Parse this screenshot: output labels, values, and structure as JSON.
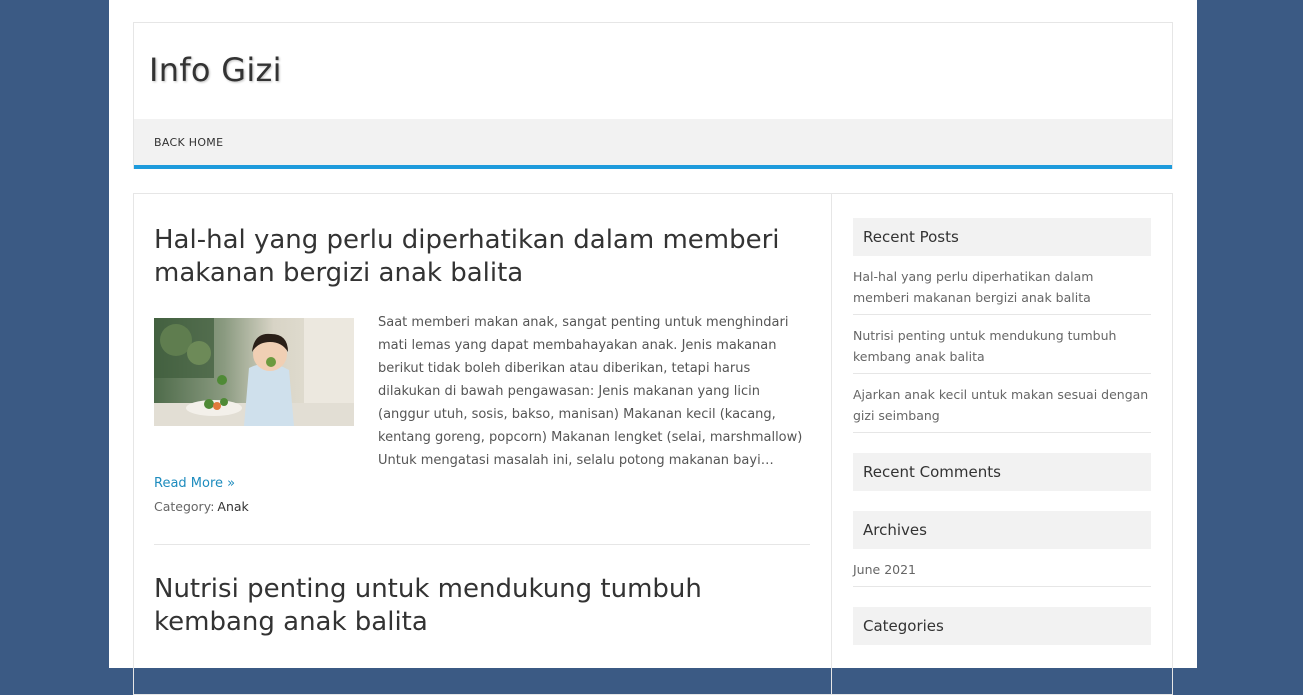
{
  "site": {
    "title": "Info Gizi"
  },
  "nav": {
    "items": [
      "BACK HOME"
    ]
  },
  "posts": [
    {
      "title": "Hal-hal yang perlu diperhatikan dalam memberi makanan bergizi anak balita",
      "excerpt": "Saat memberi makan anak, sangat penting untuk menghindari mati lemas yang dapat membahayakan anak. Jenis makanan berikut tidak boleh diberikan atau diberikan, tetapi harus dilakukan di bawah pengawasan: Jenis makanan yang licin (anggur utuh, sosis, bakso, manisan) Makanan kecil (kacang, kentang goreng, popcorn) Makanan lengket (selai, marshmallow) Untuk mengatasi masalah ini, selalu potong makanan bayi…",
      "read_more": "Read More »",
      "category_label": "Category:",
      "category": "Anak"
    },
    {
      "title": "Nutrisi penting untuk mendukung tumbuh kembang anak balita"
    }
  ],
  "sidebar": {
    "recent_posts_title": "Recent Posts",
    "recent_posts": [
      "Hal-hal yang perlu diperhatikan dalam memberi makanan bergizi anak balita",
      "Nutrisi penting untuk mendukung tumbuh kembang anak balita",
      "Ajarkan anak kecil untuk makan sesuai dengan gizi seimbang"
    ],
    "recent_comments_title": "Recent Comments",
    "archives_title": "Archives",
    "archives": [
      "June 2021"
    ],
    "categories_title": "Categories"
  },
  "colors": {
    "background": "#3b5a84",
    "accent": "#1e9bdc",
    "link": "#1e8cbe"
  }
}
